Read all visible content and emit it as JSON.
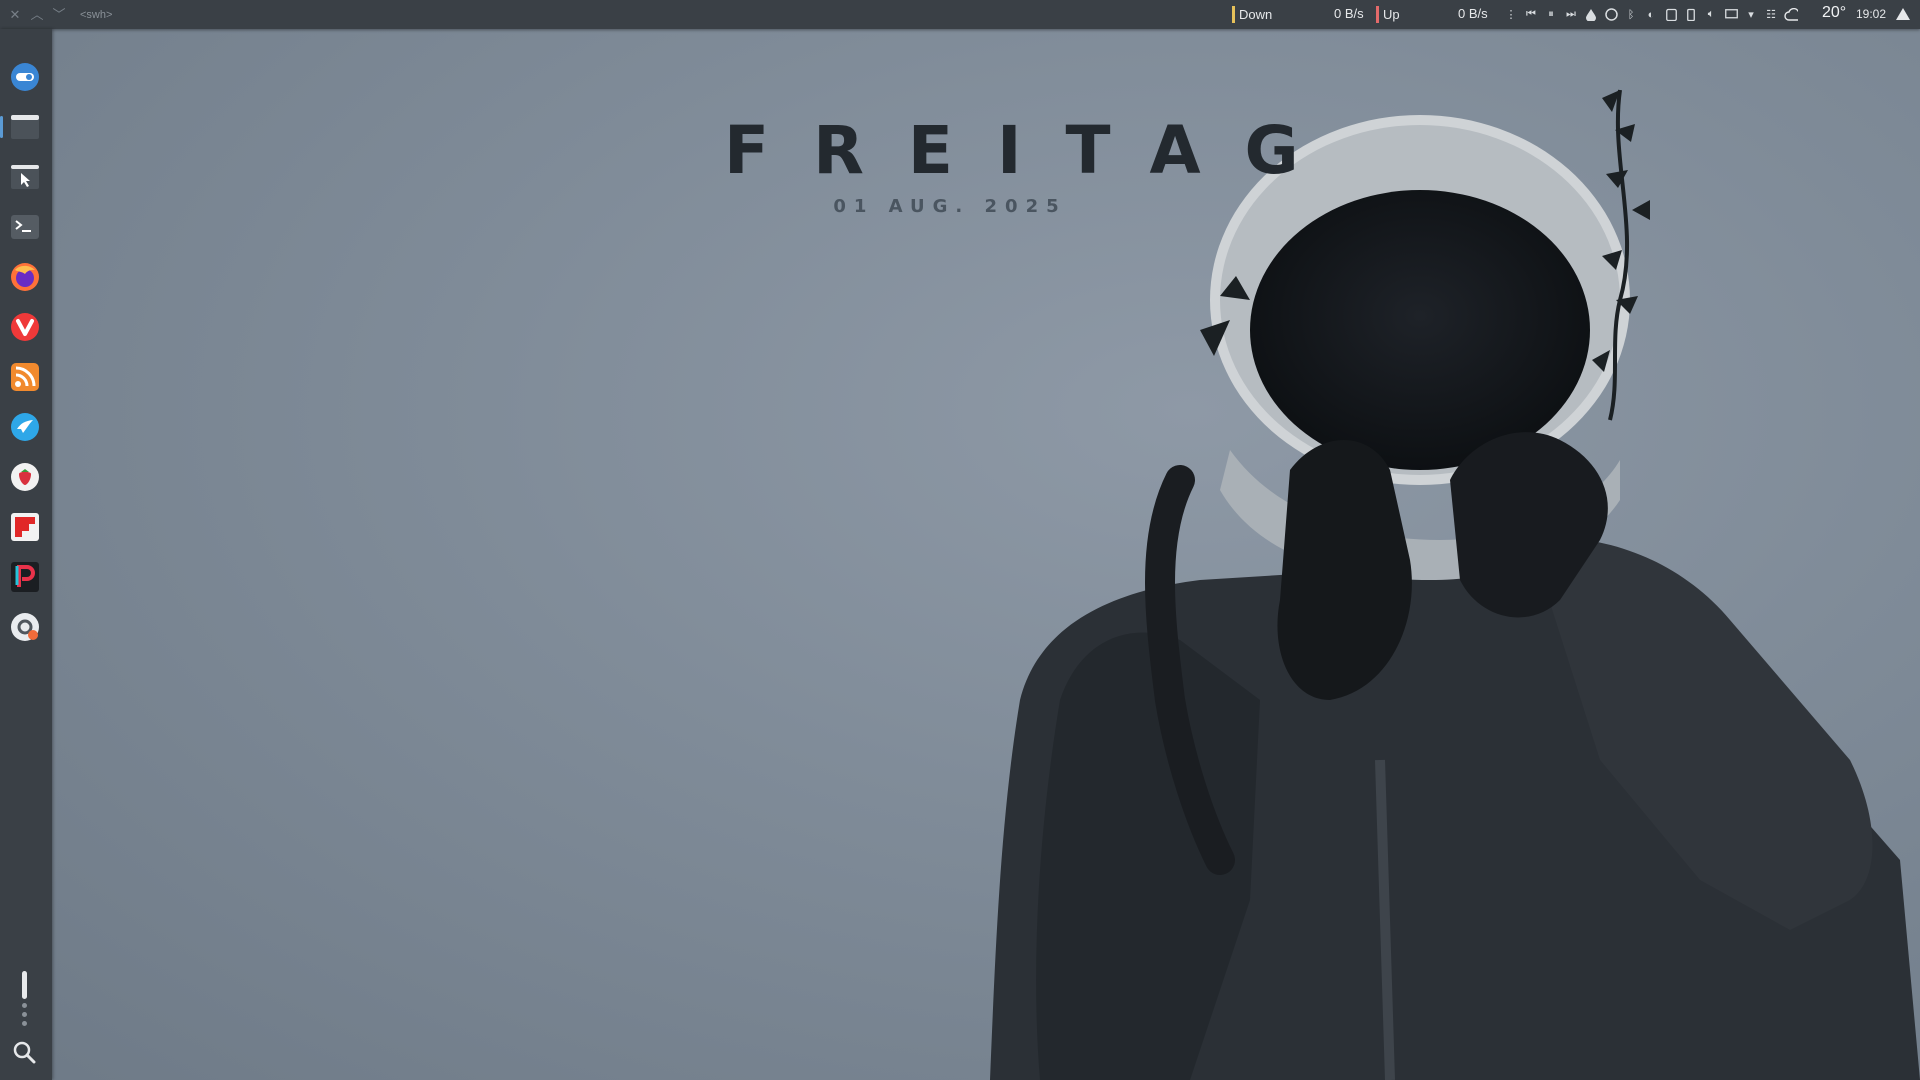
{
  "top_panel": {
    "window_title": "<swh>",
    "net_down": {
      "label": "Down",
      "value": "0 B/s"
    },
    "net_up": {
      "label": "Up",
      "value": "0 B/s"
    },
    "weather": {
      "temperature": "20°",
      "icon": "cloud-icon"
    },
    "clock": "19:02"
  },
  "desktop": {
    "clock_widget": {
      "day": "FREITAG",
      "date": "01 AUG. 2025"
    }
  },
  "dock": {
    "items": [
      {
        "name": "toggle-app",
        "icon": "toggle-icon"
      },
      {
        "name": "file-manager-window",
        "icon": "window-icon"
      },
      {
        "name": "window-pointer",
        "icon": "window-pointer-icon"
      },
      {
        "name": "terminal",
        "icon": "terminal-icon"
      },
      {
        "name": "firefox",
        "icon": "firefox-icon"
      },
      {
        "name": "vivaldi",
        "icon": "vivaldi-icon"
      },
      {
        "name": "rss-reader",
        "icon": "rss-icon"
      },
      {
        "name": "bird-app",
        "icon": "bird-icon"
      },
      {
        "name": "strawberry-music",
        "icon": "strawberry-icon"
      },
      {
        "name": "flipboard",
        "icon": "flipboard-icon"
      },
      {
        "name": "p-app",
        "icon": "p-app-icon"
      },
      {
        "name": "disk-app",
        "icon": "disk-icon"
      }
    ],
    "search_icon": "search-icon"
  },
  "colors": {
    "panel": "#3a4046",
    "down_bar": "#e6c15a",
    "up_bar": "#e36a6a",
    "accent": "#5b9bd5"
  }
}
